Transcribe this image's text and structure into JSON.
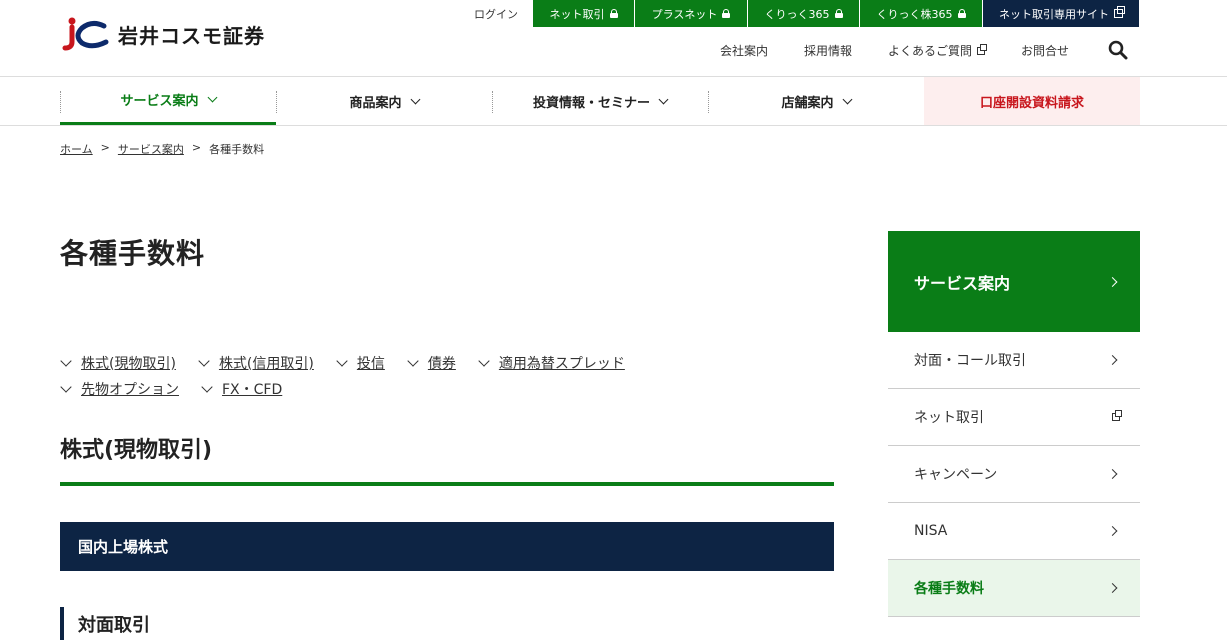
{
  "header": {
    "logo_text": "岩井コスモ証券",
    "login_label": "ログイン",
    "top_buttons": [
      "ネット取引",
      "プラスネット",
      "くりっく365",
      "くりっく株365",
      "ネット取引専用サイト"
    ],
    "sub_links": [
      "会社案内",
      "採用情報",
      "よくあるご質問",
      "お問合せ"
    ],
    "colors": {
      "green": "#0a7d17",
      "navy": "#0d2444",
      "red": "#c8161d"
    }
  },
  "gnav": {
    "items": [
      "サービス案内",
      "商品案内",
      "投資情報・セミナー",
      "店舗案内"
    ],
    "request_label": "口座開設資料請求"
  },
  "breadcrumb": [
    "ホーム",
    "サービス案内",
    "各種手数料"
  ],
  "main": {
    "title": "各種手数料",
    "anchors_row1": [
      "株式(現物取引)",
      "株式(信用取引)",
      "投信",
      "債券",
      "適用為替スプレッド"
    ],
    "anchors_row2": [
      "先物オプション",
      "FX・CFD"
    ],
    "h2": "株式(現物取引)",
    "h3": "国内上場株式",
    "h4": "対面取引"
  },
  "side": {
    "head": "サービス案内",
    "items": [
      "対面・コール取引",
      "ネット取引",
      "キャンペーン",
      "NISA",
      "各種手数料"
    ]
  }
}
